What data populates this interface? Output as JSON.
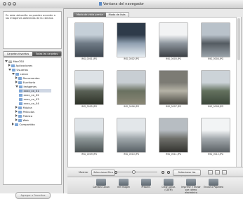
{
  "window": {
    "title": "Ventana del navegador"
  },
  "sidebar": {
    "message": "En esta ubicación no pueden acceder a las imágenes obtenidas de la cámara.",
    "segments": [
      "Carpetas favoritas",
      "Todas las carpetas"
    ],
    "tree": [
      {
        "label": "MacOSX",
        "level": 0,
        "expanded": true,
        "kind": "disk"
      },
      {
        "label": "Aplicaciones",
        "level": 1,
        "expanded": false,
        "kind": "folder"
      },
      {
        "label": "Usuarios",
        "level": 1,
        "expanded": true,
        "kind": "folder"
      },
      {
        "label": "canon",
        "level": 2,
        "expanded": true,
        "kind": "folder"
      },
      {
        "label": "Documentos",
        "level": 3,
        "expanded": false,
        "kind": "folder"
      },
      {
        "label": "Escritorio",
        "level": 3,
        "expanded": false,
        "kind": "folder"
      },
      {
        "label": "Imágenes",
        "level": 3,
        "expanded": true,
        "kind": "folder"
      },
      {
        "label": "xxxx_xx_01",
        "level": 4,
        "expanded": false,
        "kind": "folder",
        "selected": true
      },
      {
        "label": "xxxx_xx_02",
        "level": 4,
        "expanded": false,
        "kind": "folder"
      },
      {
        "label": "xxxx_xx_03",
        "level": 4,
        "expanded": false,
        "kind": "folder"
      },
      {
        "label": "xxxx_xx_04",
        "level": 4,
        "expanded": false,
        "kind": "folder"
      },
      {
        "label": "Música",
        "level": 3,
        "expanded": false,
        "kind": "folder"
      },
      {
        "label": "Películas",
        "level": 3,
        "expanded": false,
        "kind": "folder"
      },
      {
        "label": "Pública",
        "level": 3,
        "expanded": false,
        "kind": "folder"
      },
      {
        "label": "Web",
        "level": 3,
        "expanded": false,
        "kind": "folder"
      },
      {
        "label": "Compartido",
        "level": 2,
        "expanded": false,
        "kind": "folder"
      }
    ],
    "add_favorite": "Agregar a Favoritos"
  },
  "main": {
    "tabs": [
      "Modo de vista previa",
      "Modo de lista"
    ],
    "thumbnails": [
      {
        "caption": "IMG_0001.JPG",
        "colors": [
          "#c5cfd8",
          "#6f7b86",
          "#3d4650"
        ]
      },
      {
        "caption": "IMG_0002.JPG",
        "colors": [
          "#2e3b4a",
          "#8f9fb0",
          "#e8eef3"
        ]
      },
      {
        "caption": "IMG_0003.JPG",
        "colors": [
          "#f2f3f4",
          "#8e969e",
          "#3c4045"
        ]
      },
      {
        "caption": "IMG_0004.JPG",
        "colors": [
          "#b9c2ca",
          "#545b61",
          "#9aa3aa"
        ]
      },
      {
        "caption": "IMG_0005.JPG",
        "colors": [
          "#dde2e6",
          "#5a6156",
          "#2d3127"
        ]
      },
      {
        "caption": "IMG_0006.JPG",
        "colors": [
          "#c8ced3",
          "#6a7160",
          "#8a8776"
        ]
      },
      {
        "caption": "IMG_0007.JPG",
        "colors": [
          "#7c7b74",
          "#b5b2a6",
          "#4a4942"
        ]
      },
      {
        "caption": "IMG_0008.JPG",
        "colors": [
          "#ccd3d8",
          "#63715e",
          "#3c473a"
        ]
      },
      {
        "caption": "IMG_0009.JPG",
        "colors": [
          "#dfe4e8",
          "#8d9798",
          "#4b5253"
        ]
      },
      {
        "caption": "IMG_0010.JPG",
        "colors": [
          "#e3e7ea",
          "#9fa7ab",
          "#586065"
        ]
      },
      {
        "caption": "IMG_0011.JPG",
        "colors": [
          "#b7bdc2",
          "#6e6f6a",
          "#33332f"
        ]
      },
      {
        "caption": "IMG_0012.JPG",
        "colors": [
          "#f2f4f5",
          "#a3a9ad",
          "#5a6064"
        ]
      }
    ],
    "toolbar1": {
      "filter_label": "Mostrar",
      "filter_value": "Seleccionar filtro",
      "select_all": "Seleccionar las imágenes"
    },
    "toolbar2": [
      {
        "label": "Cámara Canon",
        "icon": "camera-icon"
      },
      {
        "label": "Ver imagen",
        "icon": "view-image-icon"
      },
      {
        "label": "Present.",
        "icon": "slideshow-icon"
      },
      {
        "label": "Crear panor. (CATM)",
        "icon": "panorama-icon"
      },
      {
        "label": "Imprimir y enviar por correo electrónico",
        "icon": "print-email-icon"
      },
      {
        "label": "Enviar a Papelera",
        "icon": "trash-icon"
      }
    ]
  }
}
